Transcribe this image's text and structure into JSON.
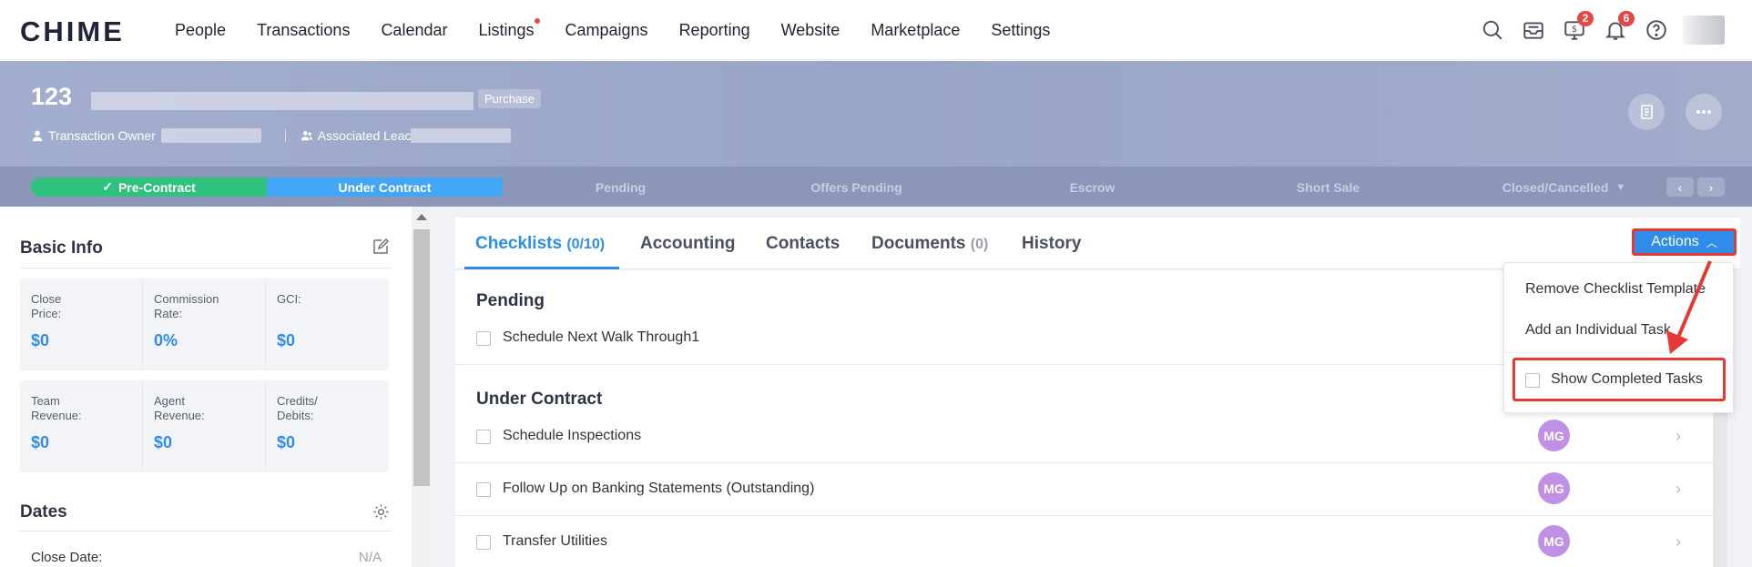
{
  "app": {
    "logo": "CHIME"
  },
  "nav": {
    "items": [
      {
        "label": "People",
        "dot": false
      },
      {
        "label": "Transactions",
        "dot": false
      },
      {
        "label": "Calendar",
        "dot": false
      },
      {
        "label": "Listings",
        "dot": true
      },
      {
        "label": "Campaigns",
        "dot": false
      },
      {
        "label": "Reporting",
        "dot": false
      },
      {
        "label": "Website",
        "dot": false
      },
      {
        "label": "Marketplace",
        "dot": false
      },
      {
        "label": "Settings",
        "dot": false
      }
    ],
    "icons": {
      "search": "search-icon",
      "inbox": "inbox-icon",
      "money": "money-monitor-icon",
      "bell": "bell-icon",
      "help": "help-icon"
    },
    "money_badge": "2",
    "bell_badge": "6"
  },
  "header": {
    "title": "123",
    "type_badge": "Purchase",
    "owner_label": "Transaction Owner",
    "associated_label": "Associated Leac"
  },
  "stages": [
    {
      "label": "Pre-Contract",
      "state": "done"
    },
    {
      "label": "Under Contract",
      "state": "current"
    },
    {
      "label": "Pending",
      "state": "todo"
    },
    {
      "label": "Offers Pending",
      "state": "todo"
    },
    {
      "label": "Escrow",
      "state": "todo"
    },
    {
      "label": "Short Sale",
      "state": "todo"
    },
    {
      "label": "Closed/Cancelled",
      "state": "todo"
    }
  ],
  "basic_info": {
    "title": "Basic Info",
    "row1": [
      {
        "label": "Close Price:",
        "value": "$0"
      },
      {
        "label": "Commission Rate:",
        "value": "0%"
      },
      {
        "label": "GCI:",
        "value": "$0"
      }
    ],
    "row2": [
      {
        "label": "Team Revenue:",
        "value": "$0"
      },
      {
        "label": "Agent Revenue:",
        "value": "$0"
      },
      {
        "label": "Credits/ Debits:",
        "value": "$0"
      }
    ]
  },
  "dates": {
    "title": "Dates",
    "close_date_label": "Close Date:",
    "close_date_value": "N/A"
  },
  "tabs": {
    "checklists": "Checklists",
    "checklists_count": "(0/10)",
    "accounting": "Accounting",
    "contacts": "Contacts",
    "documents": "Documents",
    "documents_count": "(0)",
    "history": "History"
  },
  "actions": {
    "label": "Actions"
  },
  "dropdown": {
    "remove": "Remove Checklist Template",
    "add": "Add an Individual Task",
    "show_completed": "Show Completed Tasks"
  },
  "checklist": {
    "groups": [
      {
        "title": "Pending",
        "tasks": [
          {
            "label": "Schedule Next Walk Through1",
            "assignee": ""
          }
        ]
      },
      {
        "title": "Under Contract",
        "tasks": [
          {
            "label": "Schedule Inspections",
            "assignee": "MG"
          },
          {
            "label": "Follow Up on Banking Statements (Outstanding)",
            "assignee": "MG"
          },
          {
            "label": "Transfer Utilities",
            "assignee": "MG"
          }
        ]
      }
    ]
  },
  "colors": {
    "accent": "#2f8ceb",
    "done": "#2ec27e",
    "current": "#42a5f5",
    "highlight": "#e53935",
    "avatar": "#c08fe6"
  }
}
